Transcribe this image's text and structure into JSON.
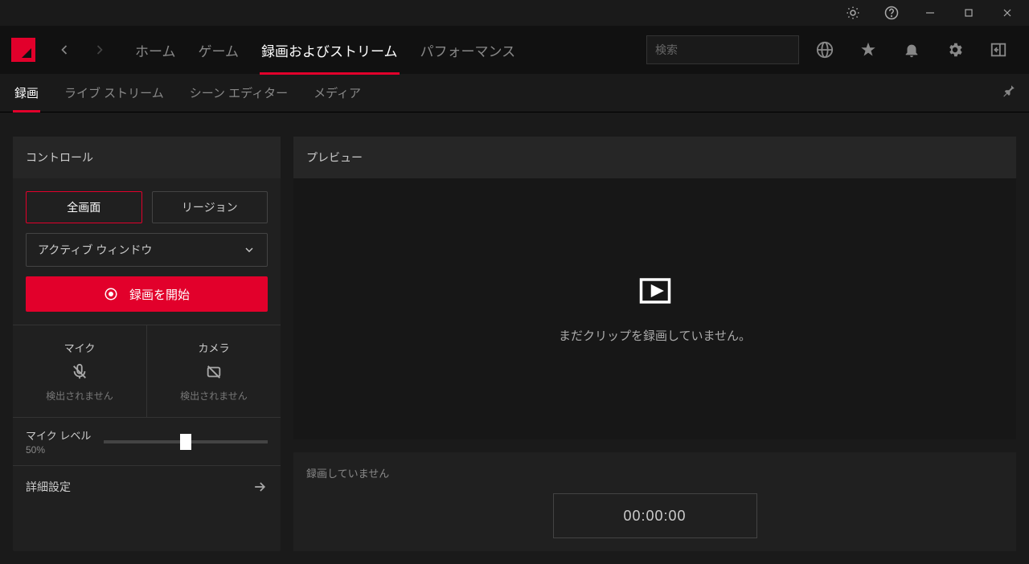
{
  "colors": {
    "accent": "#e2002b"
  },
  "search": {
    "placeholder": "検索"
  },
  "nav": {
    "home": "ホーム",
    "game": "ゲーム",
    "record": "録画およびストリーム",
    "perf": "パフォーマンス"
  },
  "subnav": {
    "record": "録画",
    "live": "ライブ ストリーム",
    "scene": "シーン エディター",
    "media": "メディア"
  },
  "controls": {
    "title": "コントロール",
    "fullscreen": "全画面",
    "region": "リージョン",
    "window_select": "アクティブ ウィンドウ",
    "start_record": "録画を開始",
    "mic_label": "マイク",
    "camera_label": "カメラ",
    "not_detected": "検出されません",
    "mic_level_label": "マイク レベル",
    "mic_level_value": "50%",
    "advanced": "詳細設定"
  },
  "preview": {
    "title": "プレビュー",
    "empty_msg": "まだクリップを録画していません。"
  },
  "recording": {
    "status": "録画していません",
    "timer": "00:00:00"
  }
}
